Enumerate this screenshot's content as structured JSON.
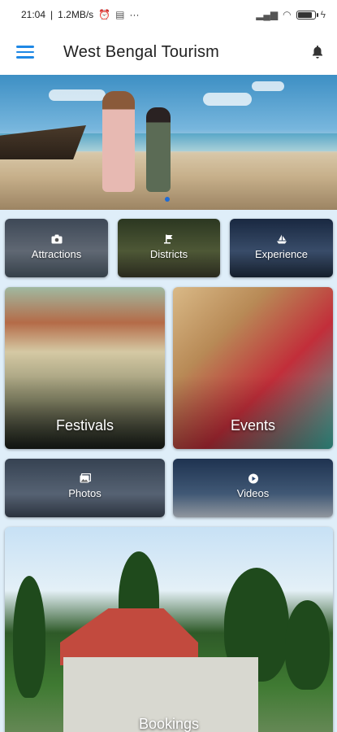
{
  "status_bar": {
    "time": "21:04",
    "network_speed": "1.2MB/s",
    "alarm_icon": "alarm-icon",
    "message_icon": "message-icon",
    "more": "···",
    "battery_level": 0.9,
    "charging_icon": "bolt-icon"
  },
  "app_bar": {
    "title": "West Bengal Tourism",
    "menu_icon": "hamburger-menu-icon",
    "notification_icon": "bell-icon"
  },
  "hero": {
    "carousel_active_index": 0
  },
  "categories": {
    "attractions": {
      "label": "Attractions",
      "icon": "camera-icon"
    },
    "districts": {
      "label": "Districts",
      "icon": "flag-icon"
    },
    "experience": {
      "label": "Experience",
      "icon": "sailboat-icon"
    },
    "festivals": {
      "label": "Festivals"
    },
    "events": {
      "label": "Events"
    },
    "photos": {
      "label": "Photos",
      "icon": "photos-icon"
    },
    "videos": {
      "label": "Videos",
      "icon": "play-icon"
    },
    "bookings": {
      "label": "Bookings"
    }
  },
  "colors": {
    "accent": "#1e88e5",
    "page_background": "#dfeef9"
  }
}
